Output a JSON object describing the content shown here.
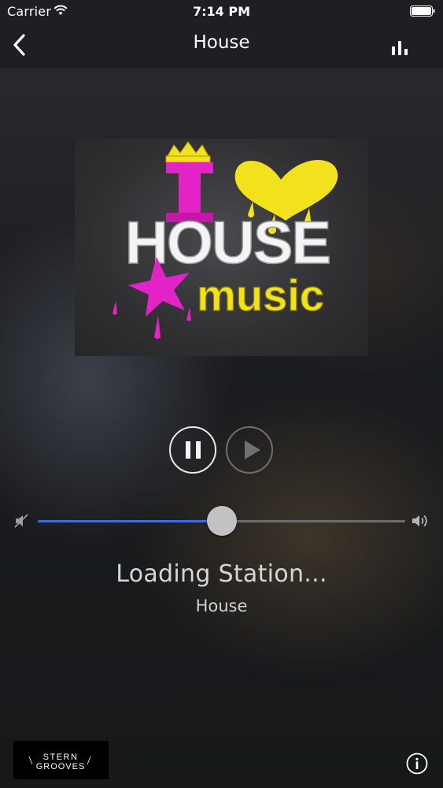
{
  "status_bar": {
    "carrier": "Carrier",
    "time": "7:14 PM"
  },
  "nav": {
    "title": "House",
    "back_icon": "chevron-left-icon",
    "right_icon": "equalizer-icon"
  },
  "artwork": {
    "line1": "I",
    "line2": "HOUSE",
    "line3": "music"
  },
  "player": {
    "volume_level": 0.5,
    "status": "Loading Station...",
    "station": "House"
  },
  "footer": {
    "sponsor_line1": "STERN",
    "sponsor_line2": "GROOVES",
    "info_icon": "info-icon"
  },
  "colors": {
    "accent": "#3a6fd6",
    "pink": "#e223c6",
    "yellow": "#f2e21d"
  }
}
